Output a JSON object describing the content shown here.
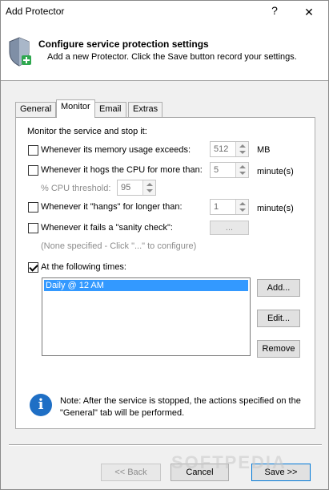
{
  "window": {
    "title": "Add Protector",
    "help_glyph": "?",
    "close_glyph": "✕"
  },
  "header": {
    "title": "Configure service protection settings",
    "subtitle": "Add a new Protector. Click the Save button record your settings.",
    "icon": "shield-add-icon"
  },
  "tabs": [
    "General",
    "Monitor",
    "Email",
    "Extras"
  ],
  "active_tab": "Monitor",
  "monitor": {
    "heading": "Monitor the service and stop it:",
    "memory": {
      "label": "Whenever its memory usage exceeds:",
      "value": "512",
      "unit": "MB",
      "checked": false
    },
    "cpu": {
      "label": "Whenever it hogs the CPU for more than:",
      "value": "5",
      "unit": "minute(s)",
      "checked": false
    },
    "cpu_threshold": {
      "label": "% CPU threshold:",
      "value": "95"
    },
    "hangs": {
      "label": "Whenever it \"hangs\" for longer than:",
      "value": "1",
      "unit": "minute(s)",
      "checked": false
    },
    "sanity": {
      "label": "Whenever it fails a \"sanity check\":",
      "button": "...",
      "hint": "(None specified - Click \"...\" to configure)",
      "checked": false
    },
    "times": {
      "label": "At the following times:",
      "checked": true,
      "items": [
        "Daily @ 12 AM"
      ]
    },
    "buttons": {
      "add": "Add...",
      "edit": "Edit...",
      "remove": "Remove"
    },
    "note": "Note: After the service is stopped, the actions specified on the \"General\" tab will be performed."
  },
  "footer": {
    "back": "<< Back",
    "cancel": "Cancel",
    "save": "Save >>"
  },
  "watermark": "SOFTPEDIA"
}
